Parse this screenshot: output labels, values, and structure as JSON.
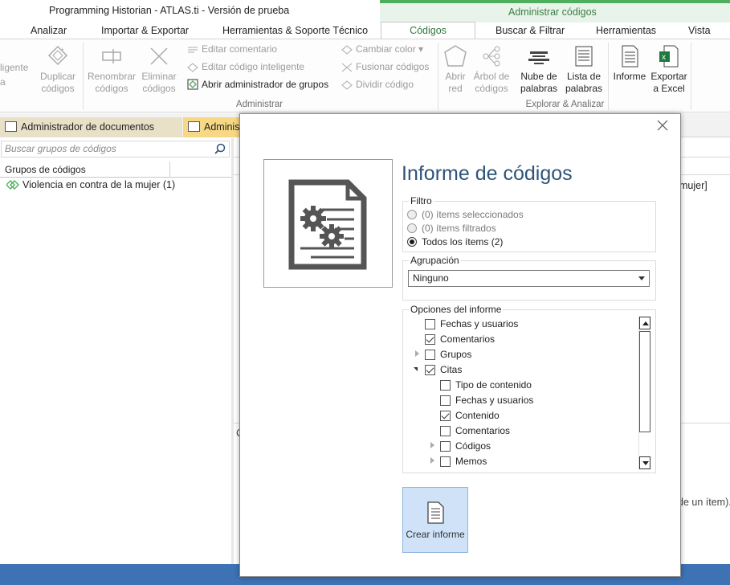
{
  "window": {
    "title": "Programming Historian - ATLAS.ti - Versión de prueba"
  },
  "context_tab": {
    "label": "Administrar códigos"
  },
  "tabs": [
    {
      "label": "Analizar"
    },
    {
      "label": "Importar & Exportar"
    },
    {
      "label": "Herramientas & Soporte Técnico"
    },
    {
      "label": "Códigos"
    },
    {
      "label": "Buscar & Filtrar"
    },
    {
      "label": "Herramientas"
    },
    {
      "label": "Vista"
    }
  ],
  "ribbon": {
    "partial_left_top": "ligente",
    "partial_left_bottom": "a",
    "duplicar": {
      "line1": "Duplicar",
      "line2": "códigos"
    },
    "renombrar": {
      "line1": "Renombrar",
      "line2": "códigos"
    },
    "eliminar": {
      "line1": "Eliminar",
      "line2": "códigos"
    },
    "editar_comentario": "Editar comentario",
    "editar_inteligente": "Editar código inteligente",
    "abrir_admin_grupos": "Abrir administrador de grupos",
    "cambiar_color": "Cambiar color",
    "fusionar": "Fusionar códigos",
    "dividir": "Dividir código",
    "group_administrar": "Administrar",
    "abrir_red": {
      "line1": "Abrir",
      "line2": "red"
    },
    "arbol": {
      "line1": "Árbol de",
      "line2": "códigos"
    },
    "nube": {
      "line1": "Nube de",
      "line2": "palabras"
    },
    "lista": {
      "line1": "Lista de",
      "line2": "palabras"
    },
    "informe": {
      "line1": "Informe",
      "line2": ""
    },
    "exportar": {
      "line1": "Exportar",
      "line2": "a Excel"
    },
    "group_explorar": "Explorar & Analizar"
  },
  "doc_tabs": [
    {
      "label": "Administrador de documentos"
    },
    {
      "label": "Adminis"
    }
  ],
  "left_panel": {
    "search_placeholder": "Buscar grupos de códigos",
    "column_header": "Grupos de códigos",
    "group_item": "Violencia en contra de la mujer (1)"
  },
  "right_panel": {
    "cell_fragment": "mujer]",
    "note_fragment": "de un ítem).",
    "c_fragment": "C"
  },
  "dialog": {
    "title": "Informe de códigos",
    "filtro": {
      "legend": "Filtro",
      "options": [
        {
          "label": "(0) ítems seleccionados",
          "selected": false,
          "enabled": false
        },
        {
          "label": "(0) ítems filtrados",
          "selected": false,
          "enabled": false
        },
        {
          "label": "Todos los ítems (2)",
          "selected": true,
          "enabled": true
        }
      ]
    },
    "agrupacion": {
      "legend": "Agrupación",
      "value": "Ninguno"
    },
    "opciones": {
      "legend": "Opciones del informe",
      "items": [
        {
          "label": "Fechas y usuarios",
          "checked": false,
          "level": 0,
          "expander": "none"
        },
        {
          "label": "Comentarios",
          "checked": true,
          "level": 0,
          "expander": "none"
        },
        {
          "label": "Grupos",
          "checked": false,
          "level": 0,
          "expander": "closed"
        },
        {
          "label": "Citas",
          "checked": true,
          "level": 0,
          "expander": "open"
        },
        {
          "label": "Tipo de contenido",
          "checked": false,
          "level": 1,
          "expander": "none"
        },
        {
          "label": "Fechas y usuarios",
          "checked": false,
          "level": 1,
          "expander": "none"
        },
        {
          "label": "Contenido",
          "checked": true,
          "level": 1,
          "expander": "none"
        },
        {
          "label": "Comentarios",
          "checked": false,
          "level": 1,
          "expander": "none"
        },
        {
          "label": "Códigos",
          "checked": false,
          "level": 1,
          "expander": "closed"
        },
        {
          "label": "Memos",
          "checked": false,
          "level": 1,
          "expander": "closed"
        }
      ]
    },
    "create_button": "Crear informe"
  },
  "colors": {
    "accent_green": "#4fae5d",
    "title_blue": "#2e5478",
    "status_blue": "#3d72b4",
    "create_button_bg": "#cfe2f7"
  }
}
